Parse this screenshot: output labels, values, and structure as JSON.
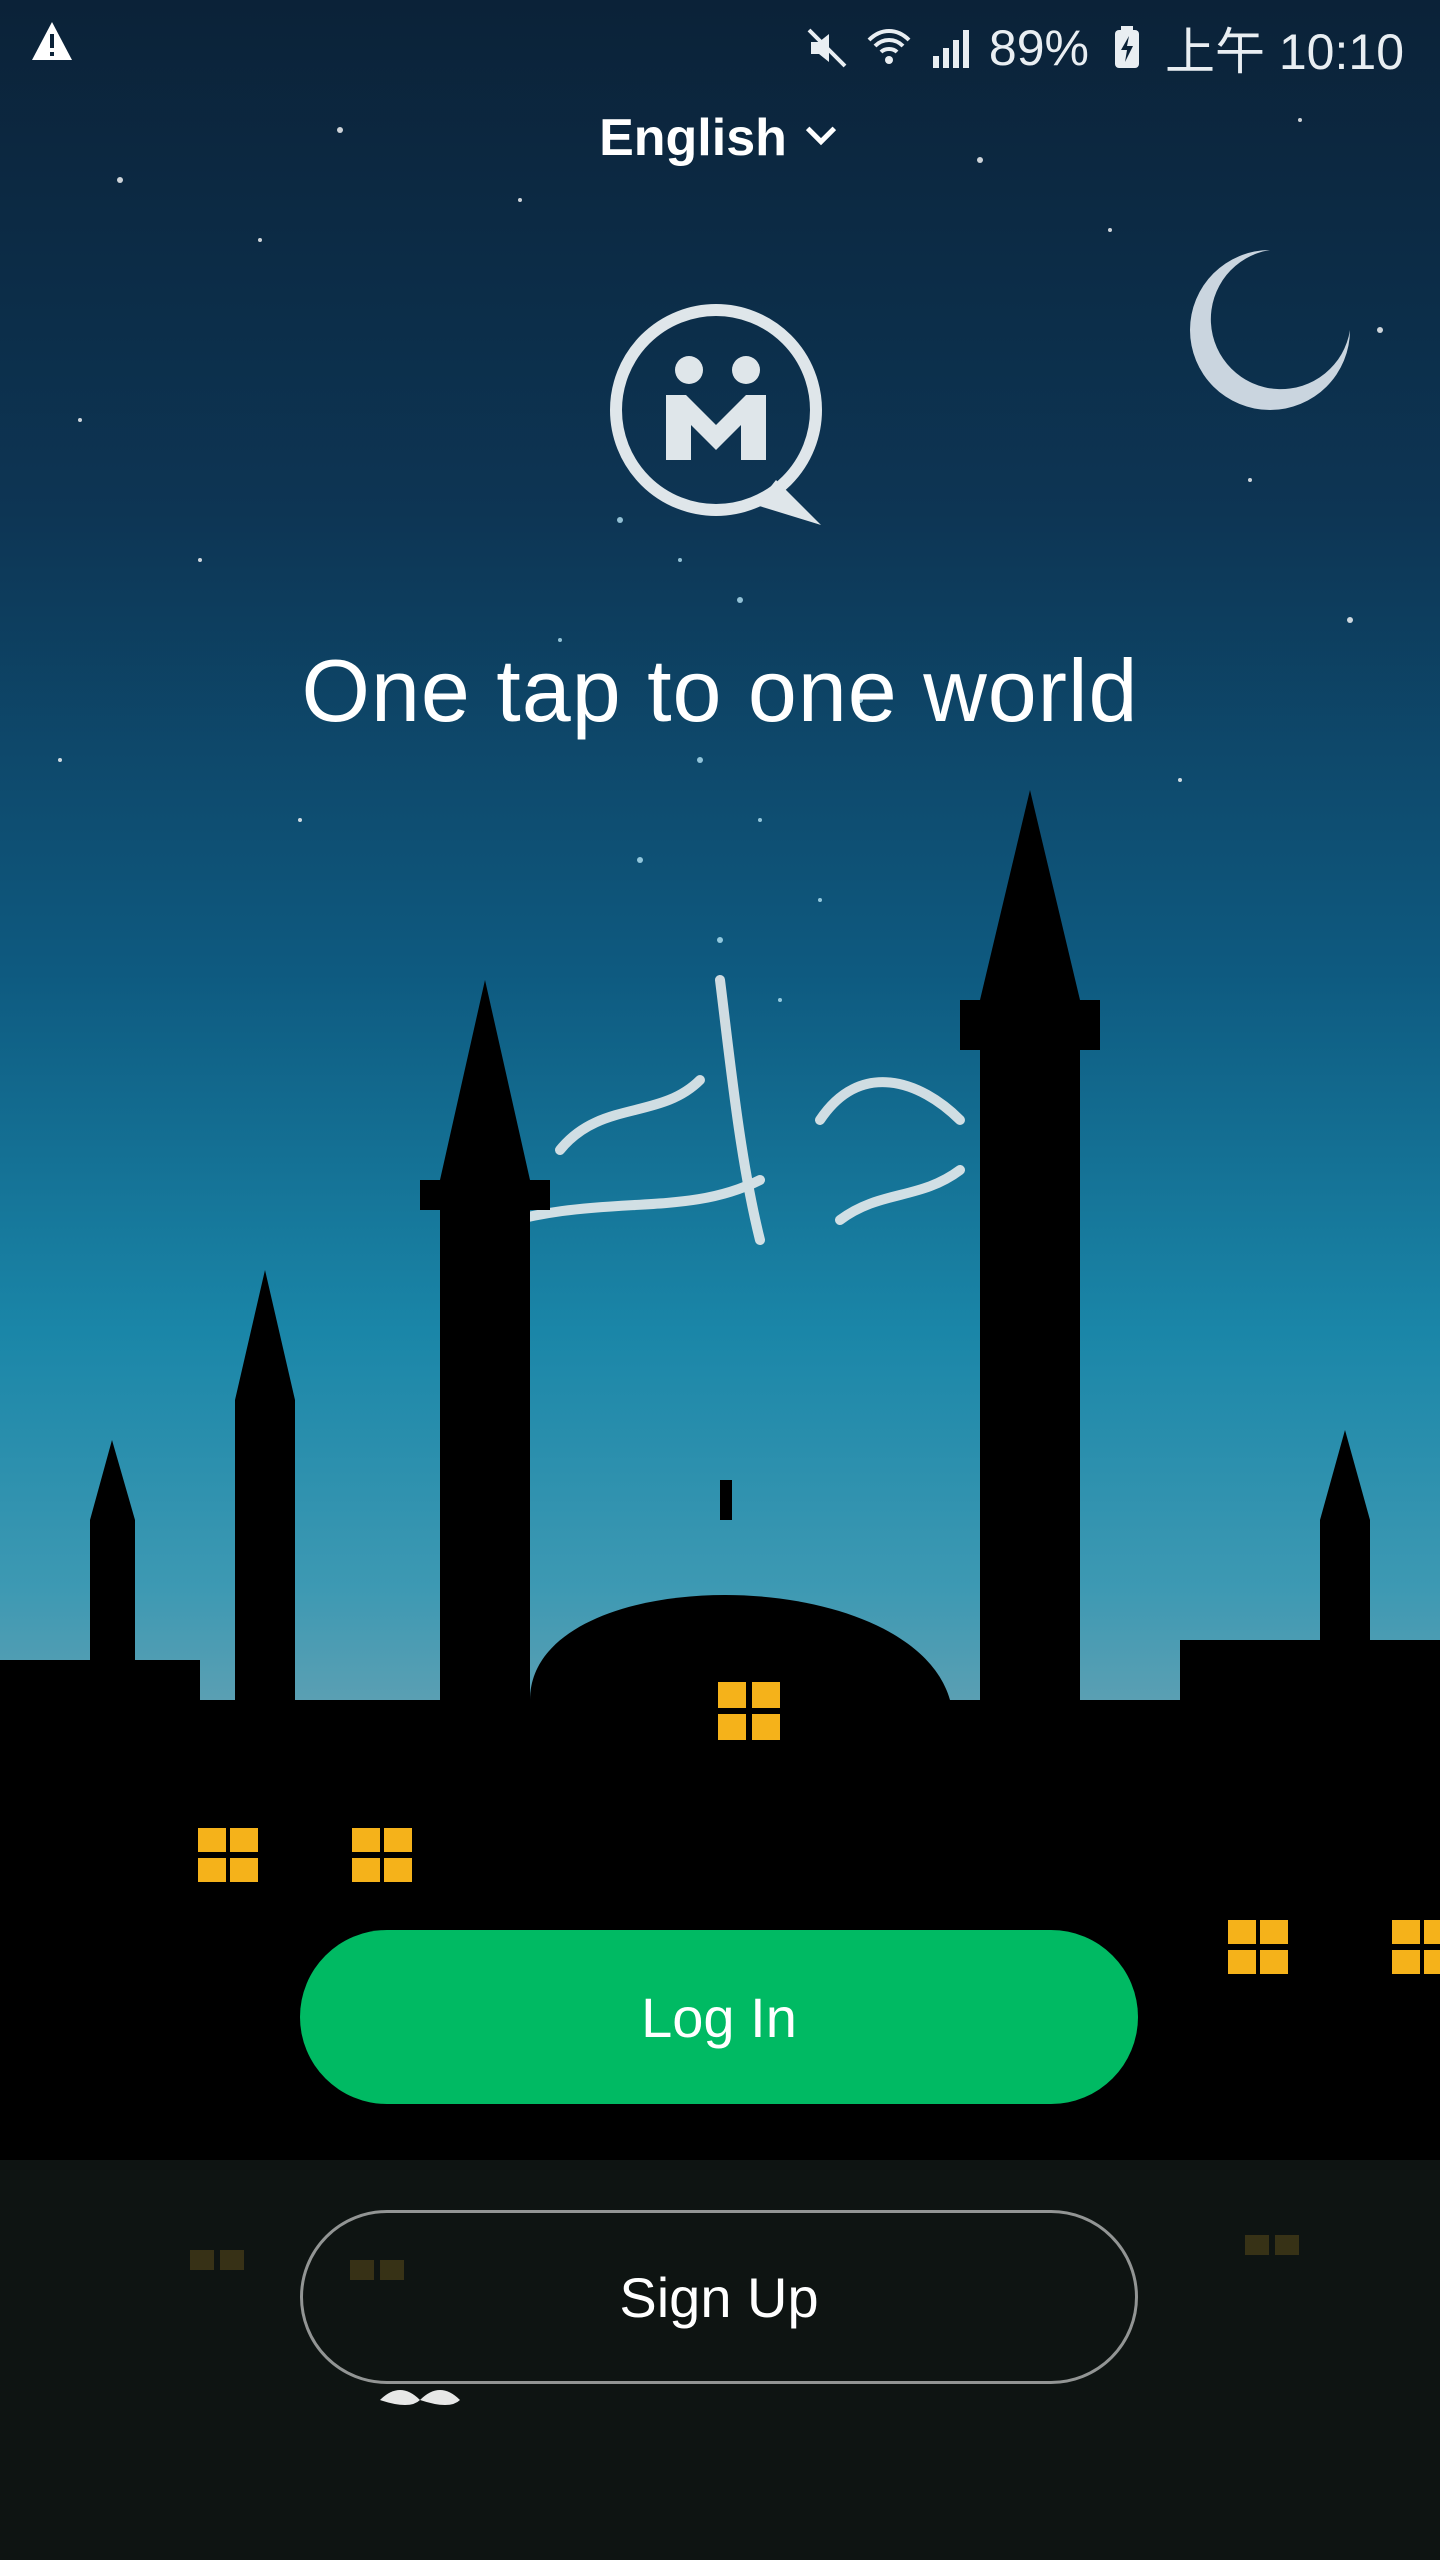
{
  "status_bar": {
    "battery": "89%",
    "time": "上午 10:10",
    "icons": [
      "warning-icon",
      "mute-icon",
      "wifi-icon",
      "signal-icon",
      "battery-charging-icon"
    ]
  },
  "language": {
    "label": "English",
    "icon": "chevron-down-icon"
  },
  "brand": {
    "logo_icon": "app-logo-icon",
    "tagline": "One tap to one world"
  },
  "actions": {
    "login_label": "Log In",
    "signup_label": "Sign Up"
  },
  "colors": {
    "primary_green": "#00ba63",
    "text": "#ffffff"
  }
}
